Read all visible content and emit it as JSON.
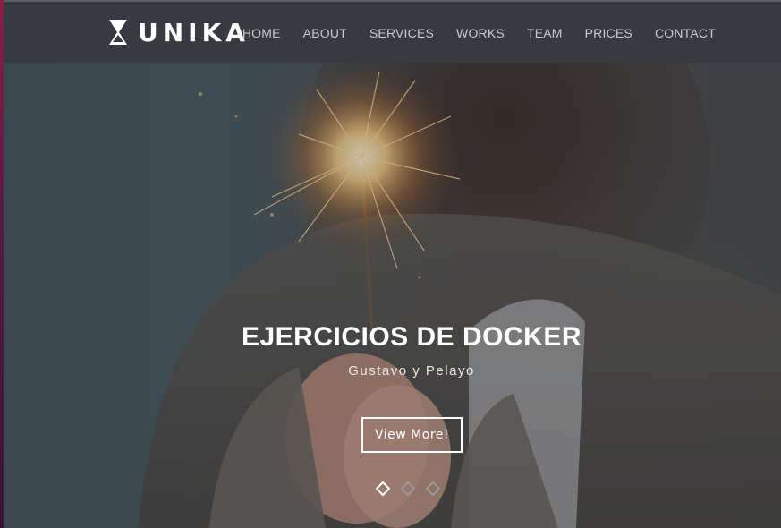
{
  "brand": {
    "name": "UNIKA",
    "logo_icon": "hourglass-icon"
  },
  "nav": {
    "items": [
      {
        "label": "HOME"
      },
      {
        "label": "ABOUT"
      },
      {
        "label": "SERVICES"
      },
      {
        "label": "WORKS"
      },
      {
        "label": "TEAM"
      },
      {
        "label": "PRICES"
      },
      {
        "label": "CONTACT"
      }
    ]
  },
  "hero": {
    "title": "EJERCICIOS DE DOCKER",
    "subtitle": "Gustavo y Pelayo",
    "button_label": "View More!",
    "slides": {
      "count": 3,
      "active_index": 0
    }
  },
  "colors": {
    "navbar": "#373a40",
    "nav_text": "#c9cbd0",
    "hero_text": "#ffffff"
  }
}
